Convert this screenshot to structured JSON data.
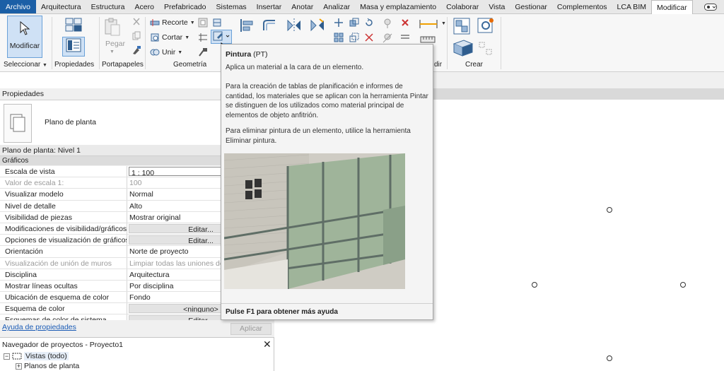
{
  "menu": {
    "tabs": [
      "Archivo",
      "Arquitectura",
      "Estructura",
      "Acero",
      "Prefabricado",
      "Sistemas",
      "Insertar",
      "Anotar",
      "Analizar",
      "Masa y emplazamiento",
      "Colaborar",
      "Vista",
      "Gestionar",
      "Complementos",
      "LCA BIM",
      "Modificar"
    ],
    "active_tab": "Modificar"
  },
  "ribbon": {
    "modify_label": "Modificar",
    "panels": {
      "select": "Seleccionar",
      "properties": "Propiedades",
      "clipboard": "Portapapeles",
      "geometry": "Geometría",
      "measure": "dir",
      "create": "Crear"
    },
    "paste_label": "Pegar",
    "cope_label": "Recorte",
    "cut_label": "Cortar",
    "join_label": "Unir"
  },
  "tooltip": {
    "title": "Pintura",
    "shortcut": "(PT)",
    "line1": "Aplica un material a la cara de un elemento.",
    "para2": "Para la creación de tablas de planificación e informes de cantidad, los materiales que se aplican con la herramienta Pintar se distinguen de los utilizados como material principal de elementos de objeto anfitrión.",
    "para3": "Para eliminar pintura de un elemento, utilice la herramienta Eliminar pintura.",
    "footer": "Pulse F1 para obtener más ayuda"
  },
  "properties": {
    "header": "Propiedades",
    "type_name": "Plano de planta",
    "instance": "Plano de planta: Nivel 1",
    "group": "Gráficos",
    "rows": [
      {
        "name": "Escala de vista",
        "value": "1 : 100",
        "kind": "input"
      },
      {
        "name": "Valor de escala    1:",
        "value": "100",
        "kind": "gray"
      },
      {
        "name": "Visualizar modelo",
        "value": "Normal",
        "kind": "text"
      },
      {
        "name": "Nivel de detalle",
        "value": "Alto",
        "kind": "text"
      },
      {
        "name": "Visibilidad de piezas",
        "value": "Mostrar original",
        "kind": "text"
      },
      {
        "name": "Modificaciones de visibilidad/gráficos",
        "value": "Editar...",
        "kind": "btn"
      },
      {
        "name": "Opciones de visualización de gráficos",
        "value": "Editar...",
        "kind": "btn"
      },
      {
        "name": "Orientación",
        "value": "Norte de proyecto",
        "kind": "text"
      },
      {
        "name": "Visualización de unión de muros",
        "value": "Limpiar todas las uniones de",
        "kind": "gray"
      },
      {
        "name": "Disciplina",
        "value": "Arquitectura",
        "kind": "text"
      },
      {
        "name": "Mostrar líneas ocultas",
        "value": "Por disciplina",
        "kind": "text"
      },
      {
        "name": "Ubicación de esquema de color",
        "value": "Fondo",
        "kind": "text"
      },
      {
        "name": "Esquema de color",
        "value": "<ninguno>",
        "kind": "btn"
      },
      {
        "name": "Esquemas de color de sistema",
        "value": "Editar...",
        "kind": "btn"
      }
    ],
    "help_link": "Ayuda de propiedades",
    "apply_label": "Aplicar"
  },
  "browser": {
    "title": "Navegador de proyectos - Proyecto1",
    "root": "Vistas (todo)",
    "child": "Planos de planta"
  },
  "colors": {
    "file_tab": "#1b5fa6",
    "selected": "#cfe1f5",
    "link": "#1a5bb5"
  }
}
